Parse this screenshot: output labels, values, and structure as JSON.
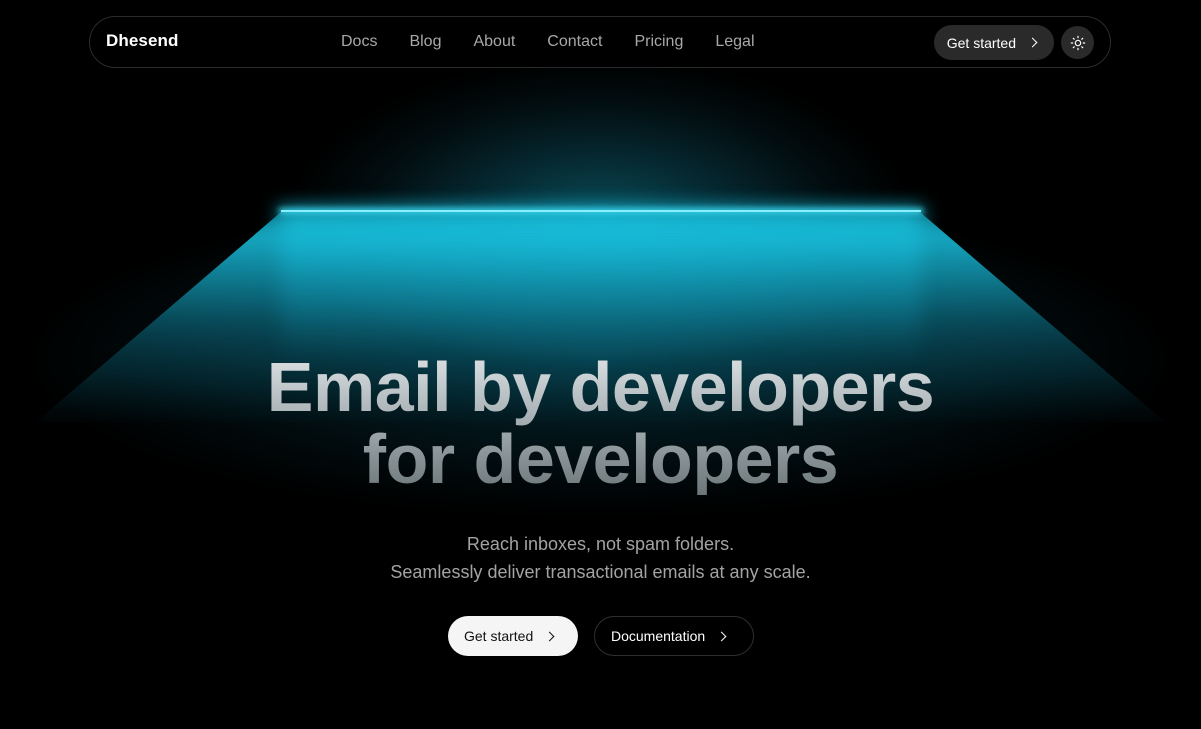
{
  "brand": {
    "name": "Dhesend"
  },
  "nav": {
    "links": [
      {
        "label": "Docs"
      },
      {
        "label": "Blog"
      },
      {
        "label": "About"
      },
      {
        "label": "Contact"
      },
      {
        "label": "Pricing"
      },
      {
        "label": "Legal"
      }
    ],
    "cta_label": "Get started",
    "theme_icon": "sun-icon"
  },
  "hero": {
    "title_line1": "Email by developers",
    "title_line2": "for developers",
    "subtitle_line1": "Reach inboxes, not spam folders.",
    "subtitle_line2": "Seamlessly deliver transactional emails at any scale.",
    "primary_cta": "Get started",
    "secondary_cta": "Documentation"
  },
  "colors": {
    "background": "#000000",
    "accent_glow": "#1bc8e6",
    "nav_text": "#a8a8a8",
    "button_light": "#f5f5f5",
    "button_dark": "#2a2a2a"
  }
}
